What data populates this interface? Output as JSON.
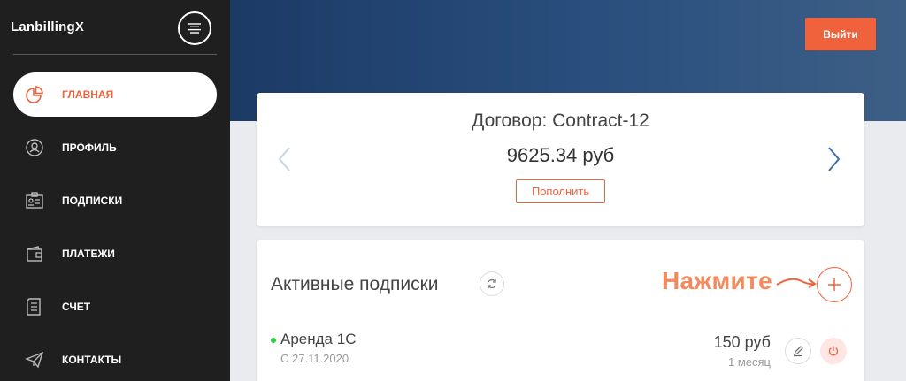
{
  "app": {
    "brand": "LanbillingX"
  },
  "sidebar": {
    "items": [
      {
        "label": "ГЛАВНАЯ",
        "icon": "pie-chart-icon",
        "active": true
      },
      {
        "label": "ПРОФИЛЬ",
        "icon": "user-circle-icon"
      },
      {
        "label": "ПОДПИСКИ",
        "icon": "id-card-icon"
      },
      {
        "label": "ПЛАТЕЖИ",
        "icon": "wallet-icon"
      },
      {
        "label": "СЧЕТ",
        "icon": "invoice-icon"
      },
      {
        "label": "КОНТАКТЫ",
        "icon": "paper-plane-icon"
      }
    ]
  },
  "header": {
    "logout_label": "Выйти"
  },
  "contract": {
    "title": "Договор: Contract-12",
    "balance": "9625.34 руб",
    "topup_label": "Пополнить"
  },
  "subscriptions": {
    "title": "Активные подписки",
    "hint": "Нажмите",
    "items": [
      {
        "name": "Аренда 1С",
        "since": "С 27.11.2020",
        "price": "150 руб",
        "period": "1 месяц",
        "status": "active"
      }
    ]
  },
  "colors": {
    "accent": "#f0623c",
    "sidebar_bg": "#1f1f1f",
    "header_gradient_start": "#1c3a66",
    "status_active": "#2ecc40"
  }
}
